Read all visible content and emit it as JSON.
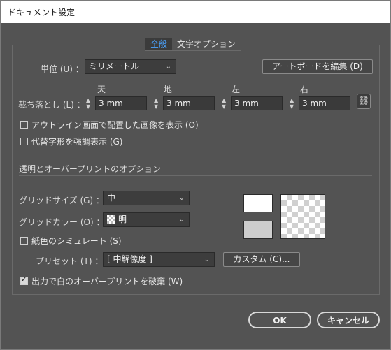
{
  "window": {
    "title": "ドキュメント設定"
  },
  "tabs": [
    {
      "label": "全般",
      "active": true
    },
    {
      "label": "文字オプション",
      "active": false
    }
  ],
  "units": {
    "label": "単位 (U) ：",
    "value": "ミリメートル"
  },
  "artboard_button": "アートボードを編集 (D)",
  "bleed": {
    "label": "裁ち落とし (L) ：",
    "columns": [
      {
        "head": "天",
        "value": "3 mm"
      },
      {
        "head": "地",
        "value": "3 mm"
      },
      {
        "head": "左",
        "value": "3 mm"
      },
      {
        "head": "右",
        "value": "3 mm"
      }
    ],
    "link_icon": "chain-link-icon"
  },
  "options": {
    "outline_images": {
      "label": "アウトライン画面で配置した画像を表示 (O)",
      "checked": false
    },
    "highlight_glyphs": {
      "label": "代替字形を強調表示 (G)",
      "checked": false
    }
  },
  "transparency": {
    "section_title": "透明とオーバープリントのオプション",
    "grid_size": {
      "label": "グリッドサイズ (G) ：",
      "value": "中"
    },
    "grid_color": {
      "label": "グリッドカラー (O) ：",
      "value": "明"
    },
    "simulate_paper": {
      "label": "紙色のシミュレート (S)",
      "checked": false
    },
    "preset": {
      "label": "プリセット (T) ：",
      "value": "[ 中解像度 ]"
    },
    "custom_button": "カスタム (C)...",
    "discard_white": {
      "label": "出力で白のオーバープリントを破棄 (W)",
      "checked": true
    }
  },
  "footer": {
    "ok": "OK",
    "cancel": "キャンセル"
  },
  "colors": {
    "background": "#535353",
    "active_tab": "#4aa3ff",
    "field": "#3d3d3d"
  }
}
